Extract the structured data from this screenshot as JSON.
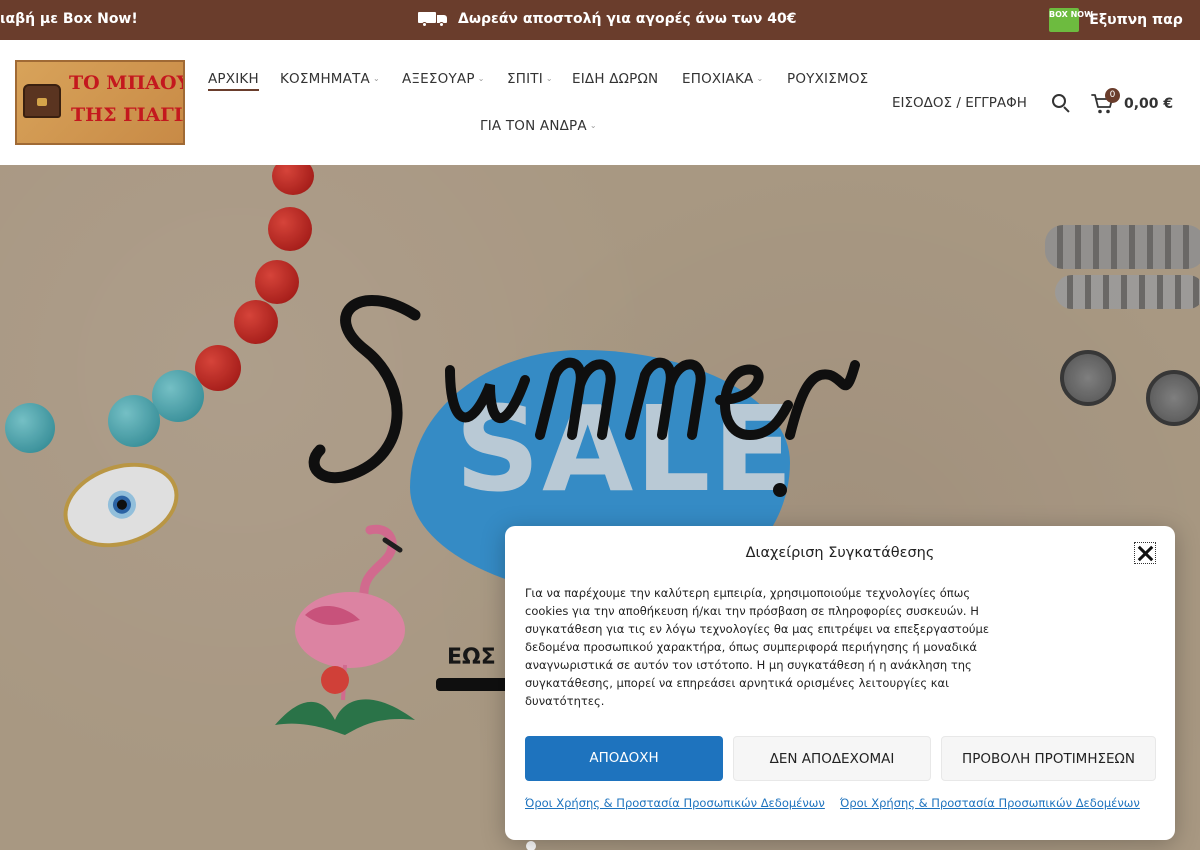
{
  "topbar": {
    "left_text": "ιαβή με Box Now!",
    "center_text": "Δωρεάν αποστολή για αγορές άνω των 40€",
    "right_badge": "BOX NOW",
    "right_text": "Έξυπνη παρ",
    "bg_color": "#6a3d2c"
  },
  "header": {
    "logo": {
      "line1": "ΤΟ ΜΠΑΟΥΛΟ",
      "line2": "ΤΗΣ ΓΙΑΓΙΑΣ"
    },
    "nav": [
      {
        "label": "ΑΡΧΙΚΗ",
        "dropdown": false,
        "active": true
      },
      {
        "label": "ΚΟΣΜΗΜΑΤΑ",
        "dropdown": true
      },
      {
        "label": "ΑΞΕΣΟΥΑΡ",
        "dropdown": true
      },
      {
        "label": "ΣΠΙΤΙ",
        "dropdown": true
      },
      {
        "label": "ΕΙΔΗ ΔΩΡΩΝ",
        "dropdown": false
      },
      {
        "label": "ΕΠΟΧΙΑΚΑ",
        "dropdown": true
      },
      {
        "label": "ΡΟΥΧΙΣΜΟΣ",
        "dropdown": false
      },
      {
        "label": "ΓΙΑ ΤΟΝ ΑΝΔΡΑ",
        "dropdown": true
      }
    ],
    "login": "ΕΙΣΟΔΟΣ / ΕΓΓΡΑΦΗ",
    "cart_count": "0",
    "cart_total": "0,00 €",
    "icons": {
      "search": "search-icon",
      "cart": "cart-icon",
      "chevron": "chevron-down-icon"
    }
  },
  "hero": {
    "script_text": "Summer",
    "sale_text": "SALE",
    "partial_text": "ΕΩΣ"
  },
  "cookie": {
    "title": "Διαχείριση Συγκατάθεσης",
    "body": "Για να παρέχουμε την καλύτερη εμπειρία, χρησιμοποιούμε τεχνολογίες όπως cookies για την αποθήκευση ή/και την πρόσβαση σε πληροφορίες συσκευών. Η συγκατάθεση για τις εν λόγω τεχνολογίες θα μας επιτρέψει να επεξεργαστούμε δεδομένα προσωπικού χαρακτήρα, όπως συμπεριφορά περιήγησης ή μοναδικά αναγνωριστικά σε αυτόν τον ιστότοπο. Η μη συγκατάθεση ή η ανάκληση της συγκατάθεσης, μπορεί να επηρεάσει αρνητικά ορισμένες λειτουργίες και δυνατότητες.",
    "accept": "ΑΠΟΔΟΧΗ",
    "deny": "ΔΕΝ ΑΠΟΔΕΧΟΜΑΙ",
    "prefs": "ΠΡΟΒΟΛΗ ΠΡΟΤΙΜΗΣΕΩΝ",
    "link1": "Όροι Χρήσης & Προστασία Προσωπικών Δεδομένων",
    "link2": "Όροι Χρήσης & Προστασία Προσωπικών Δεδομένων",
    "accent_color": "#1e73be"
  }
}
